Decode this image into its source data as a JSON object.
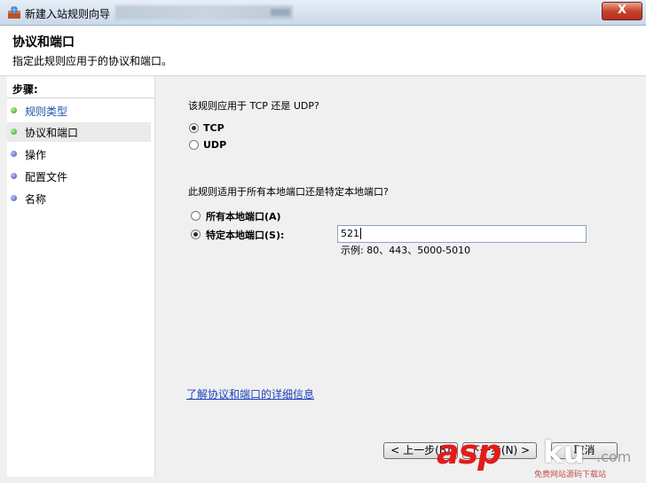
{
  "window": {
    "title": "新建入站规则向导",
    "close_label": "X"
  },
  "header": {
    "title": "协议和端口",
    "description": "指定此规则应用于的协议和端口。"
  },
  "steps": {
    "label": "步骤:",
    "items": [
      {
        "label": "规则类型",
        "status": "done"
      },
      {
        "label": "协议和端口",
        "status": "current"
      },
      {
        "label": "操作",
        "status": "pending"
      },
      {
        "label": "配置文件",
        "status": "pending"
      },
      {
        "label": "名称",
        "status": "pending"
      }
    ]
  },
  "protocol": {
    "question": "该规则应用于 TCP 还是 UDP?",
    "options": [
      {
        "label": "TCP",
        "selected": true
      },
      {
        "label": "UDP",
        "selected": false
      }
    ]
  },
  "ports": {
    "question": "此规则适用于所有本地端口还是特定本地端口?",
    "options": [
      {
        "label": "所有本地端口(A)",
        "selected": false
      },
      {
        "label": "特定本地端口(S):",
        "selected": true
      }
    ],
    "value": "521",
    "example": "示例: 80、443、5000-5010"
  },
  "more_link": "了解协议和端口的详细信息",
  "buttons": {
    "back": "< 上一步(B)",
    "next": "下一步(N) >",
    "cancel": "取消"
  },
  "watermark": {
    "asp": "asp",
    "ku": "ku",
    "com": ".com",
    "sub": "免费网站源码下载站"
  }
}
